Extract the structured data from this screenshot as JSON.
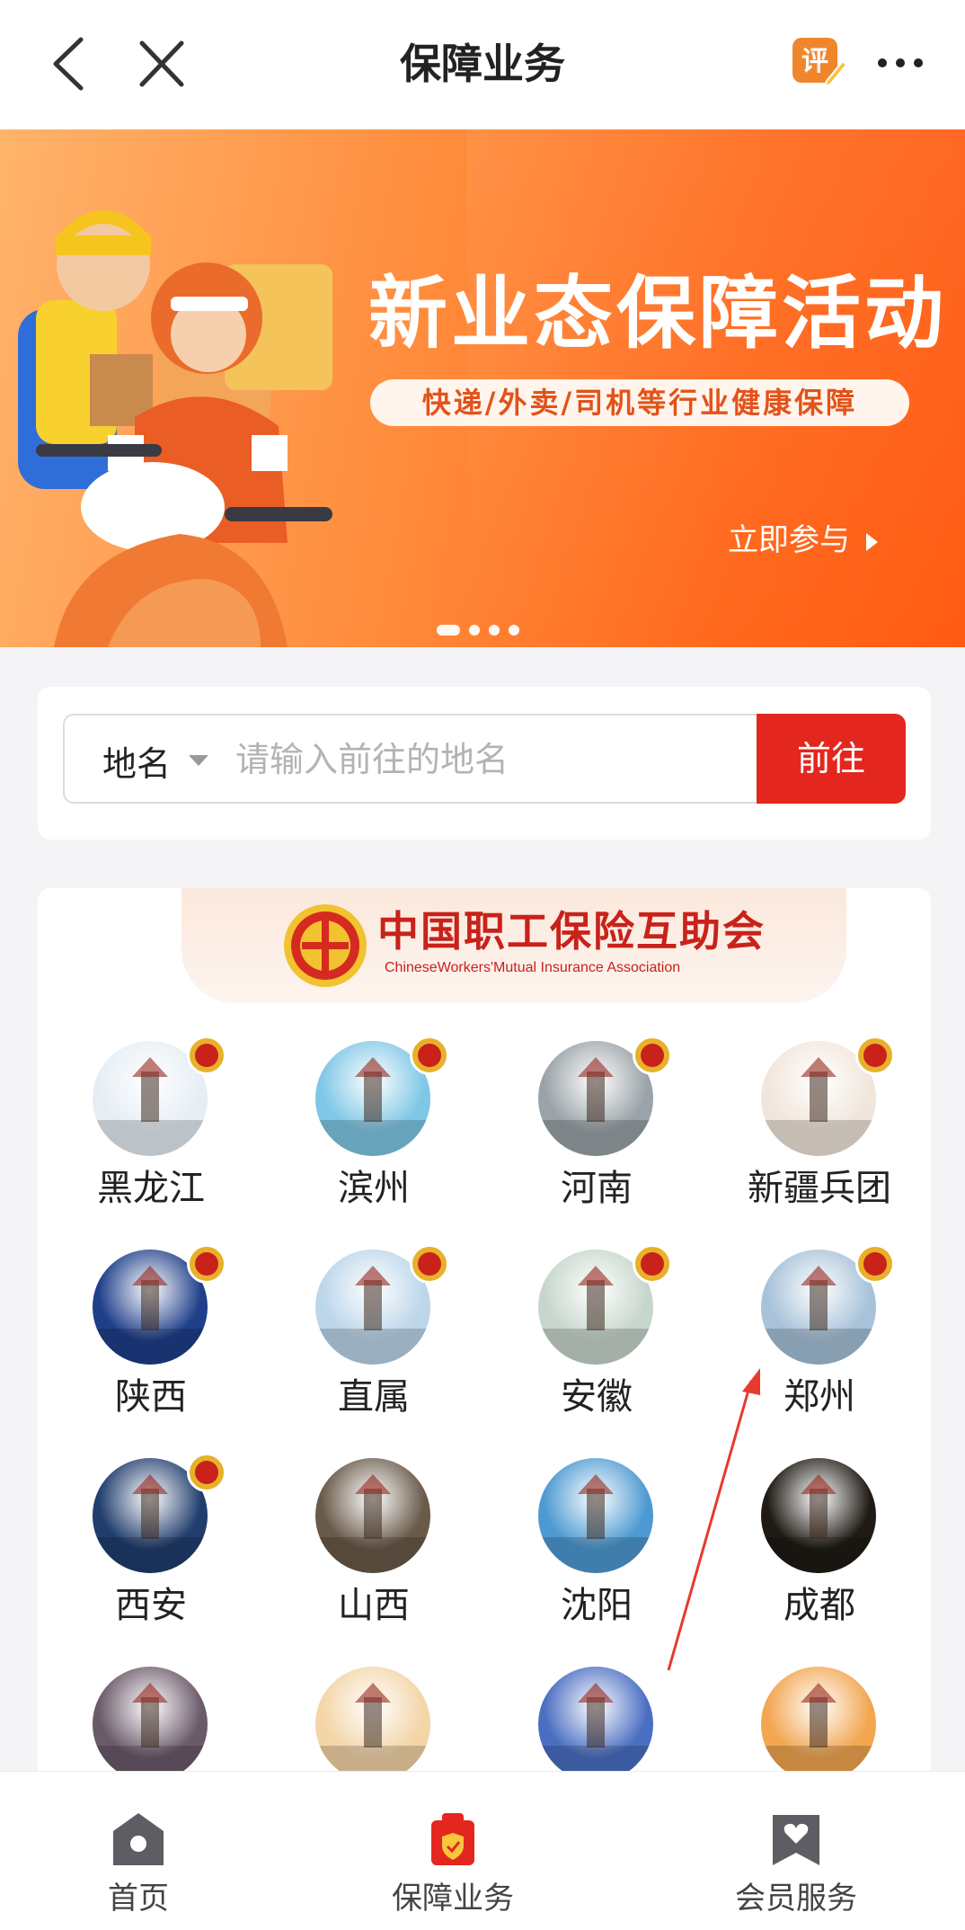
{
  "header": {
    "title": "保障业务",
    "back_icon": "chevron-left-icon",
    "close_icon": "close-icon",
    "review_label": "评",
    "more_icon": "more-dots-icon"
  },
  "banner": {
    "title": "新业态保障活动",
    "subtitle": "快递/外卖/司机等行业健康保障",
    "cta": "立即参与",
    "slide_count": 4,
    "active_slide": 1
  },
  "search": {
    "location_label": "地名",
    "placeholder": "请输入前往的地名",
    "value": "",
    "go_label": "前往"
  },
  "org": {
    "name_cn": "中国职工保险互助会",
    "name_en": "ChineseWorkers'Mutual Insurance Association"
  },
  "regions": [
    {
      "label": "黑龙江",
      "badge": true,
      "theme": "#e6eef5"
    },
    {
      "label": "滨州",
      "badge": true,
      "theme": "#7fc7e6"
    },
    {
      "label": "河南",
      "badge": true,
      "theme": "#9aa3a8"
    },
    {
      "label": "新疆兵团",
      "badge": true,
      "theme": "#f1e6dc"
    },
    {
      "label": "陕西",
      "badge": true,
      "theme": "#1f3f8a"
    },
    {
      "label": "直属",
      "badge": true,
      "theme": "#bcd6ea"
    },
    {
      "label": "安徽",
      "badge": true,
      "theme": "#c7d6cc"
    },
    {
      "label": "郑州",
      "badge": true,
      "theme": "#a7c2d9"
    },
    {
      "label": "西安",
      "badge": true,
      "theme": "#203d6d"
    },
    {
      "label": "山西",
      "badge": false,
      "theme": "#6a5a4a"
    },
    {
      "label": "沈阳",
      "badge": false,
      "theme": "#4d9ad2"
    },
    {
      "label": "成都",
      "badge": false,
      "theme": "#1f1a14"
    },
    {
      "label": "",
      "badge": false,
      "theme": "#6b5a6a"
    },
    {
      "label": "",
      "badge": false,
      "theme": "#f3d5a8"
    },
    {
      "label": "",
      "badge": false,
      "theme": "#4a6ec2"
    },
    {
      "label": "",
      "badge": false,
      "theme": "#f2a650"
    }
  ],
  "tabs": [
    {
      "label": "首页",
      "icon": "home-icon",
      "active": false
    },
    {
      "label": "保障业务",
      "icon": "shield-clipboard-icon",
      "active": true
    },
    {
      "label": "会员服务",
      "icon": "heart-bookmark-icon",
      "active": false
    }
  ],
  "colors": {
    "accent": "#e3271e",
    "banner": "#ff6a1e",
    "annotation_arrow": "#e63a2f"
  }
}
